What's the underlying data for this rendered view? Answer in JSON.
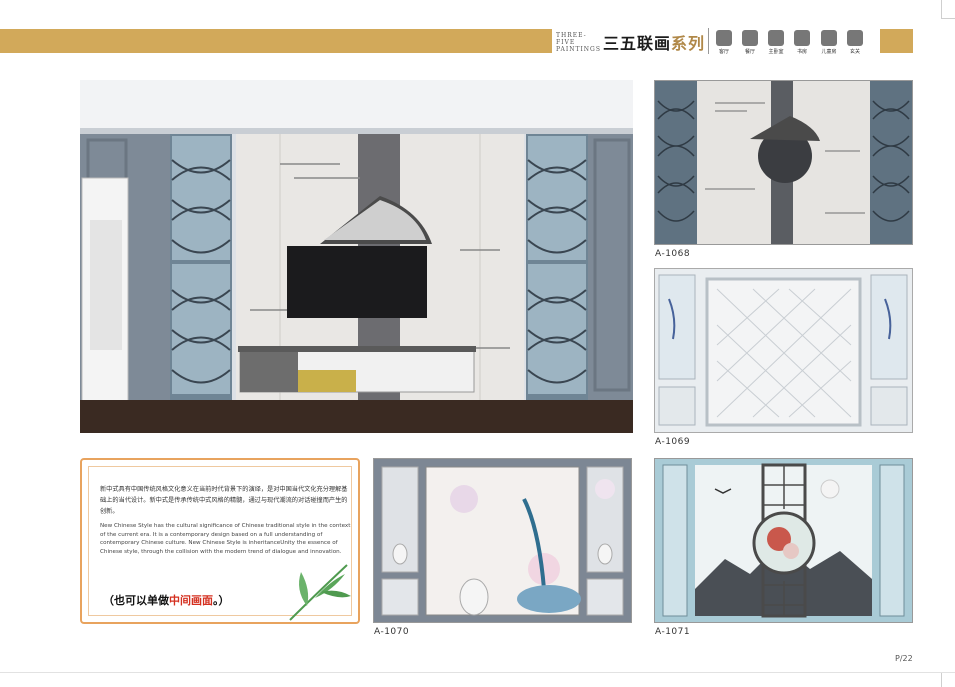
{
  "header": {
    "brand_en": "THREE-FIVE PAINTINGS",
    "brand_cn_a": "三五联画",
    "brand_cn_b": "系列",
    "icons": [
      {
        "name": "living-room-icon",
        "label": "客厅"
      },
      {
        "name": "dining-room-icon",
        "label": "餐厅"
      },
      {
        "name": "bedroom-icon",
        "label": "主卧室"
      },
      {
        "name": "study-icon",
        "label": "书房"
      },
      {
        "name": "kids-room-icon",
        "label": "儿童房"
      },
      {
        "name": "entrance-icon",
        "label": "玄关"
      }
    ]
  },
  "products": [
    {
      "code": "A-1068"
    },
    {
      "code": "A-1069"
    },
    {
      "code": "A-1070"
    },
    {
      "code": "A-1071"
    }
  ],
  "description": {
    "cn": "新中式具有中国传统风格文化意义在当前时代背景下的演绎，是对中国当代文化充分理解基础上的当代设计。新中式是传承传统中式风格的精髓，通过与现代潮流的对话碰撞而产生的创新。",
    "en": "New Chinese Style has the cultural significance of Chinese traditional style in the context of the current era. It is a contemporary design based on a full understanding of contemporary Chinese culture. New Chinese Style is inheritanceUnity the essence of Chinese style, through the collision with the modern trend of dialogue and innovation.",
    "note_a": "（也可以单做",
    "note_b": "中间画面",
    "note_c": "。）"
  },
  "page_number": "P/22",
  "colors": {
    "gold": "#d2a95a",
    "accent_red": "#d43020",
    "frame_orange": "#e8a35e"
  }
}
